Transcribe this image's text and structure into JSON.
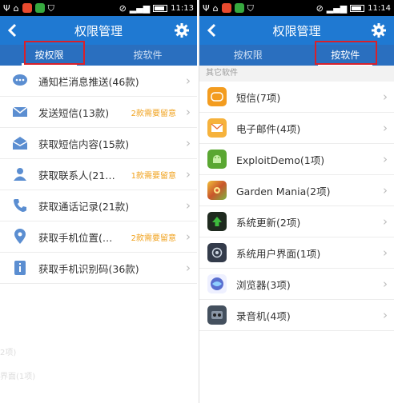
{
  "left": {
    "status": {
      "time": "11:13"
    },
    "title": "权限管理",
    "tabs": [
      {
        "label": "按权限",
        "active": true
      },
      {
        "label": "按软件",
        "active": false
      }
    ],
    "items": [
      {
        "label": "通知栏消息推送(46款)",
        "note": "",
        "icon": "chat-bubble-icon"
      },
      {
        "label": "发送短信(13款)",
        "note": "2款需要留意",
        "icon": "envelope-icon"
      },
      {
        "label": "获取短信内容(15款)",
        "note": "",
        "icon": "open-envelope-icon"
      },
      {
        "label": "获取联系人(21…",
        "note": "1款需要留意",
        "icon": "person-icon"
      },
      {
        "label": "获取通话记录(21款)",
        "note": "",
        "icon": "phone-icon"
      },
      {
        "label": "获取手机位置(…",
        "note": "2款需要留意",
        "icon": "location-pin-icon"
      },
      {
        "label": "获取手机识别码(36款)",
        "note": "",
        "icon": "id-card-icon"
      }
    ],
    "ghost_texts": [
      "2项)",
      "界面(1项)"
    ]
  },
  "right": {
    "status": {
      "time": "11:14"
    },
    "title": "权限管理",
    "tabs": [
      {
        "label": "按权限",
        "active": false
      },
      {
        "label": "按软件",
        "active": true
      }
    ],
    "section_header": "其它软件",
    "apps": [
      {
        "label": "短信(7项)",
        "icon": "sms-app-icon",
        "color": "#f39c1f"
      },
      {
        "label": "电子邮件(4项)",
        "icon": "email-app-icon",
        "color": "#f6b23c"
      },
      {
        "label": "ExploitDemo(1项)",
        "icon": "android-app-icon",
        "color": "#5aa732"
      },
      {
        "label": "Garden Mania(2项)",
        "icon": "garden-mania-icon",
        "color": "#c9552a"
      },
      {
        "label": "系统更新(2项)",
        "icon": "system-update-icon",
        "color": "#2a9a2a"
      },
      {
        "label": "系统用户界面(1项)",
        "icon": "system-ui-icon",
        "color": "#333b4a"
      },
      {
        "label": "浏览器(3项)",
        "icon": "browser-globe-icon",
        "color": "#5a6fd0"
      },
      {
        "label": "录音机(4项)",
        "icon": "recorder-app-icon",
        "color": "#44505e"
      }
    ]
  },
  "colors": {
    "title_bar": "#1f79d2",
    "tab_bar": "#2a6fbf",
    "note": "#f0a21e",
    "highlight_box": "#d9202a"
  }
}
